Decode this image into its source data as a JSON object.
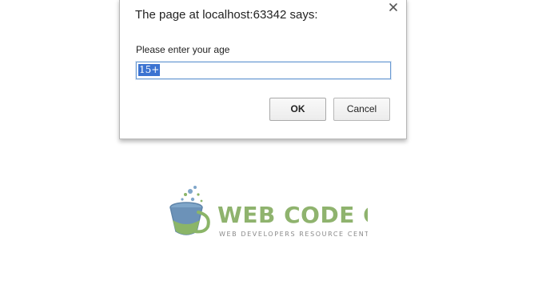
{
  "dialog": {
    "title": "The page at localhost:63342 says:",
    "message": "Please enter your age",
    "input_value": "15+",
    "ok_label": "OK",
    "cancel_label": "Cancel",
    "close_icon": "close-icon"
  },
  "logo": {
    "name": "WEB CODE GEEKS",
    "tagline": "WEB DEVELOPERS RESOURCE CENTER",
    "colors": {
      "text_green": "#8fb36e",
      "icon_blue": "#6a8fb4",
      "icon_green": "#8bb568"
    }
  },
  "colors": {
    "selection": "#3b73d1",
    "input_border": "#6b9bd3"
  }
}
